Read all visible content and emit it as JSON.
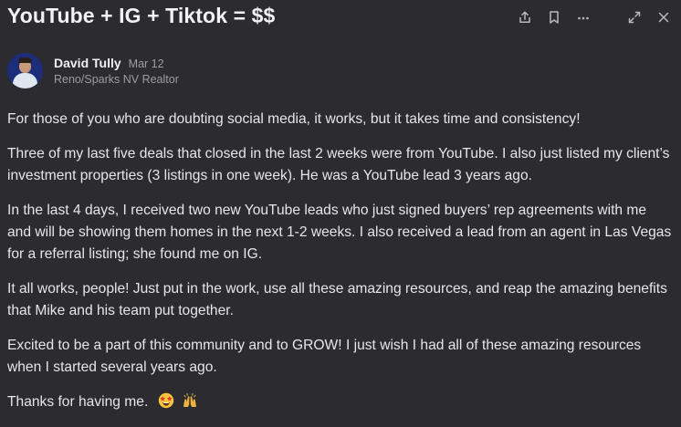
{
  "post": {
    "title": "YouTube + IG + Tiktok = $$",
    "author": {
      "name": "David Tully",
      "date": "Mar 12",
      "role": "Reno/Sparks NV Realtor"
    },
    "paragraphs": [
      "For those of you who are doubting social media, it works, but it takes time and consistency!",
      "Three of my last five deals that closed in the last 2 weeks were from YouTube. I also just listed my client’s investment properties (3 listings in one week). He was a YouTube lead 3 years ago.",
      "In the last 4 days, I received two new YouTube leads who just signed buyers’ rep agreements with me and will be showing them homes in the next 1-2 weeks. I also received a lead from an agent in Las Vegas for a referral listing; she found me on IG.",
      "It all works, people! Just put in the work, use all these amazing resources, and reap the amazing benefits that Mike and his team put together.",
      "Excited to be a part of this community and to GROW! I just wish I had all of these amazing resources when I started several years ago.",
      "Thanks for having me."
    ],
    "closing_emojis": [
      "star-struck-emoji",
      "raising-hands-emoji"
    ]
  },
  "toolbar": {
    "icons": [
      "share-icon",
      "bookmark-icon",
      "more-icon",
      "expand-icon",
      "close-icon"
    ]
  }
}
